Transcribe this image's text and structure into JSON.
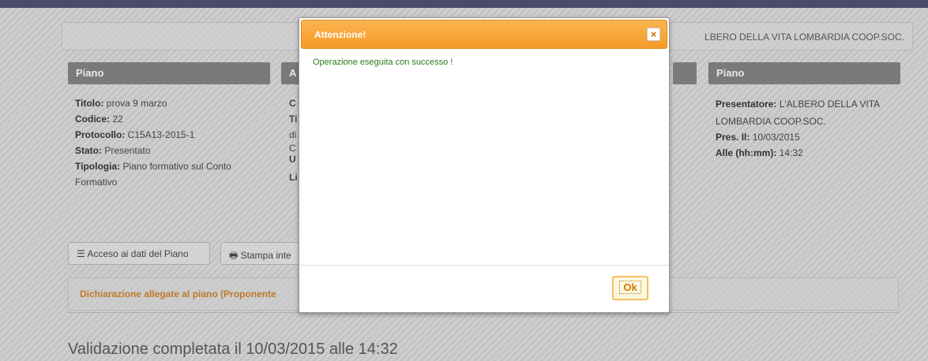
{
  "header": {
    "title_partial": "LBERO DELLA VITA LOMBARDIA COOP.SOC."
  },
  "panels": {
    "left": {
      "heading": "Piano",
      "rows": [
        {
          "label": "Titolo:",
          "value": " prova 9 marzo"
        },
        {
          "label": "Codice:",
          "value": " 22"
        },
        {
          "label": "Protocollo:",
          "value": " C15A13-2015-1"
        },
        {
          "label": "Stato:",
          "value": " Presentato"
        },
        {
          "label": "Tipologia:",
          "value": " Piano formativo sul Conto Formativo"
        }
      ]
    },
    "middle": {
      "heading_letter": "A",
      "lines": [
        "C",
        "Ti",
        "di",
        "C",
        "U",
        "Li"
      ]
    },
    "right": {
      "heading": "Piano",
      "presentatore_label": "Presentatore:",
      "presentatore_value": " L'ALBERO DELLA VITA LOMBARDIA COOP.SOC.",
      "pres_label": "Pres. Il:",
      "pres_value": " 10/03/2015",
      "alle_label": "Alle (hh:mm):",
      "alle_value": " 14:32"
    }
  },
  "buttons": {
    "acceso": "Acceso ai dati del Piano",
    "stampa": "Stampa inte"
  },
  "declarations": {
    "text": "Dichiarazione allegate al piano (Proponente"
  },
  "validation": {
    "text": "Validazione completata il 10/03/2015 alle 14:32"
  },
  "dialog": {
    "title": "Attenzione!",
    "close_glyph": "×",
    "message": "Operazione eseguita con successo !",
    "ok_label": "Ok"
  },
  "colors": {
    "dialog_header": "#f59b28",
    "success_text": "#2a7a1a",
    "declaration_text": "#c07a2a"
  },
  "icons": {
    "acceso": "list-icon",
    "stampa": "print-icon",
    "close": "close-icon"
  }
}
